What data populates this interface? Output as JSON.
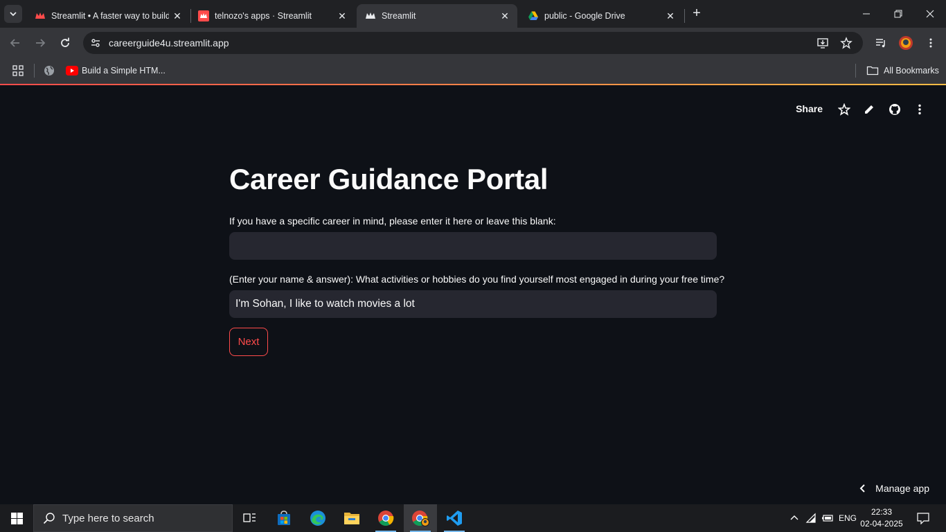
{
  "browser": {
    "tabs": [
      {
        "title": "Streamlit • A faster way to build",
        "active": false
      },
      {
        "title": "telnozo's apps · Streamlit",
        "active": false
      },
      {
        "title": "Streamlit",
        "active": true
      },
      {
        "title": "public - Google Drive",
        "active": false
      }
    ],
    "url": "careerguide4u.streamlit.app",
    "bookmarks": [
      {
        "label": "Build a Simple HTM..."
      }
    ],
    "all_bookmarks_label": "All Bookmarks"
  },
  "app": {
    "header": {
      "share_label": "Share"
    },
    "title": "Career Guidance Portal",
    "fields": [
      {
        "label": "If you have a specific career in mind, please enter it here or leave this blank:",
        "value": ""
      },
      {
        "label": "(Enter your name & answer): What activities or hobbies do you find yourself most engaged in during your free time?",
        "value": "I'm Sohan, I like to watch movies a lot"
      }
    ],
    "next_button": "Next",
    "manage_app": "Manage app",
    "colors": {
      "primary": "#ff4b4b",
      "background": "#0e1117",
      "input_bg": "#262730"
    }
  },
  "taskbar": {
    "search_placeholder": "Type here to search",
    "language": "ENG",
    "time": "22:33",
    "date": "02-04-2025",
    "pinned": [
      "task-view-icon",
      "store-icon",
      "edge-icon",
      "file-explorer-icon",
      "chrome-icon",
      "chrome-profile-icon",
      "vscode-icon"
    ]
  }
}
